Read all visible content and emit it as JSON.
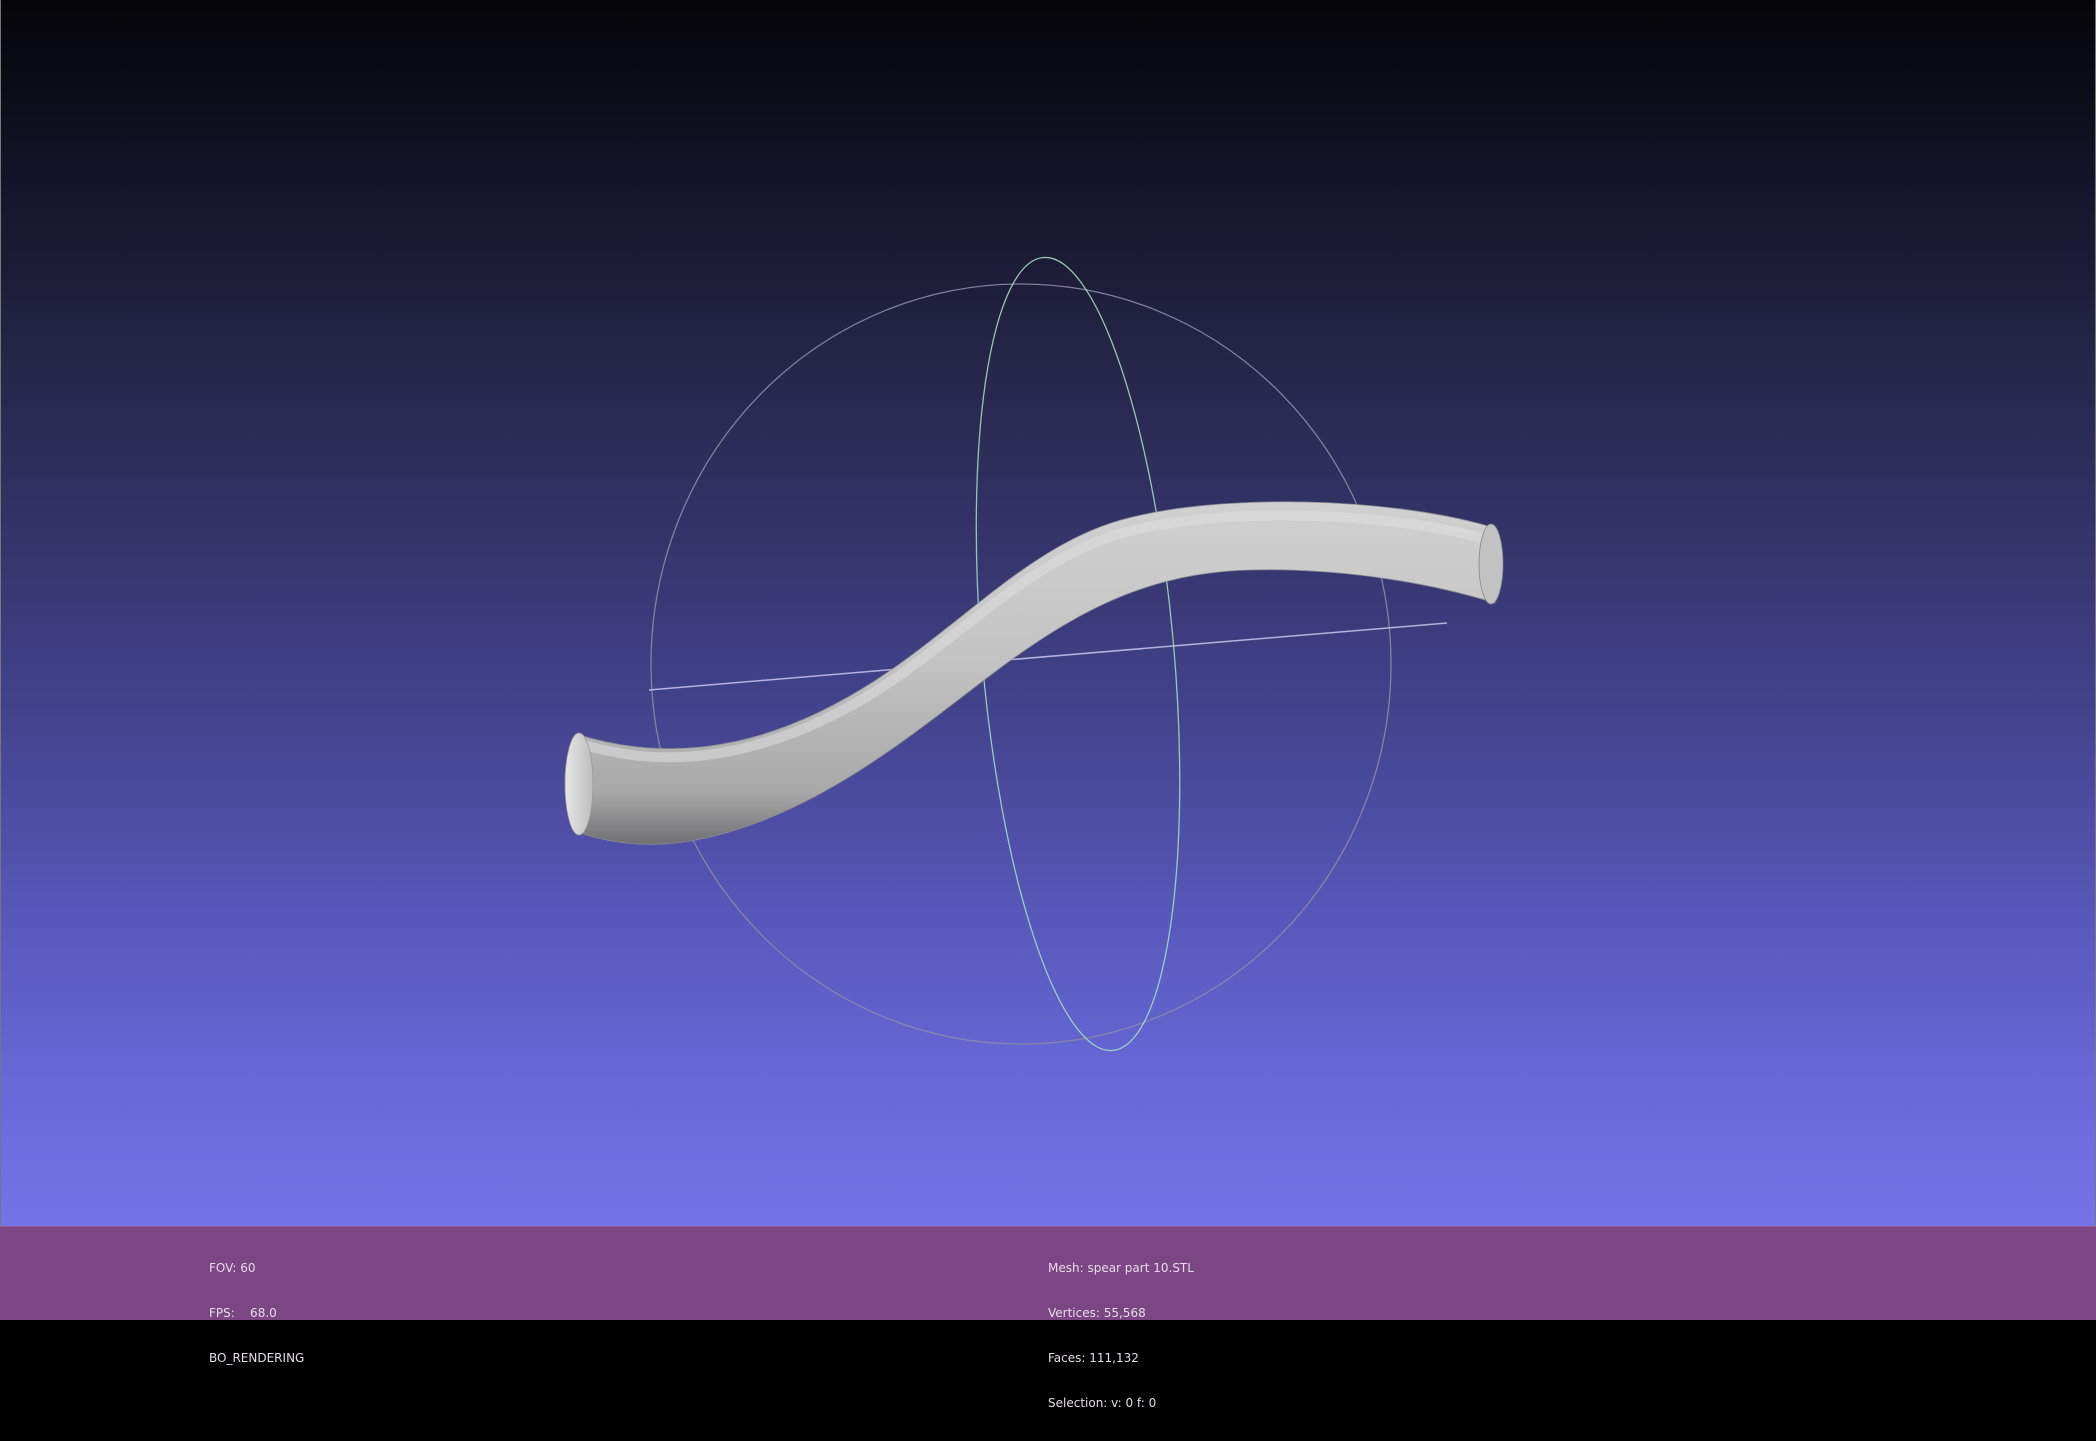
{
  "viewport": {
    "background_top": "#050508",
    "background_bottom": "#7474e8",
    "mesh_color": "#c8c8c8",
    "trackball_color": "#8a8aa8",
    "trackball_green_ring": "#a8e0c0"
  },
  "info_left": {
    "fov": "FOV: 60",
    "fps": "FPS:    68.0",
    "mode": "BO_RENDERING"
  },
  "info_right": {
    "mesh": "Mesh: spear part 10.STL",
    "vertices": "Vertices: 55,568",
    "faces": "Faces: 111,132",
    "selection": "Selection: v: 0 f: 0"
  },
  "infobar": {
    "background": "#7c4684"
  }
}
